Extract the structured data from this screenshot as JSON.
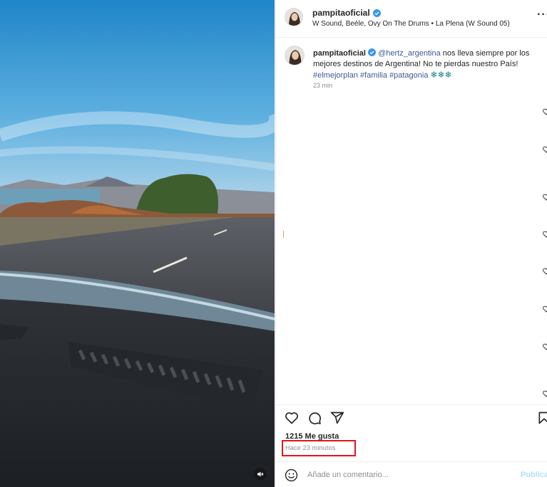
{
  "post": {
    "username": "pampitaoficial",
    "verified_icon": "verified-badge-icon",
    "audio": "W Sound, Beéle, Ovy On The Drums • La Plena (W Sound 05)"
  },
  "caption": {
    "username": "pampitaoficial",
    "mention": "@hertz_argentina",
    "text": " nos lleva siempre por los mejores destinos de Argentina! No te pierdas nuestro País!",
    "hashtags": [
      "#elmejorplan",
      "#familia",
      "#patagonia"
    ],
    "emojis": "❄❄❄",
    "time": "23 min"
  },
  "actions": {
    "like_icon": "heart-icon",
    "comment_icon": "comment-icon",
    "share_icon": "share-icon",
    "save_icon": "bookmark-icon"
  },
  "likes": "1215 Me gusta",
  "time_ago": "Hace 23 minutos",
  "comment_box": {
    "placeholder": "Añade un comentario...",
    "publish": "Publicar"
  },
  "colors": {
    "highlight": "#e0161e",
    "link": "#3d5a96",
    "publish": "#b2dffc"
  }
}
